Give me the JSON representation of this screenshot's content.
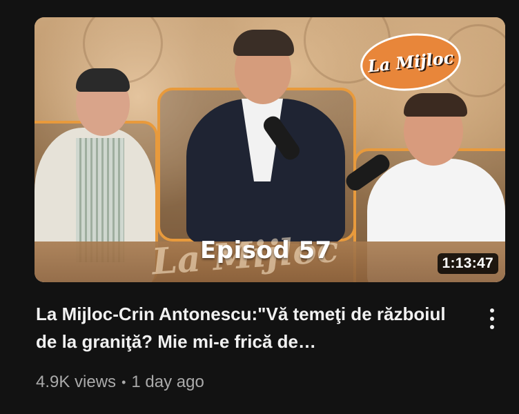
{
  "video": {
    "thumbnail": {
      "logo_text": "La Mijloc",
      "episode_text": "Episod 57",
      "watermark_text": "La Mijloc",
      "duration": "1:13:47"
    },
    "title": "La Mijloc-Crin Antonescu:\"Vă temeţi de războiul de la graniţă? Mie mi-e frică de…",
    "views": "4.9K views",
    "separator": "•",
    "age": "1 day ago"
  },
  "icons": {
    "menu": "more-vertical-icon"
  },
  "colors": {
    "background": "#121212",
    "title_text": "#f1f1f1",
    "meta_text": "#aaaaaa",
    "accent_orange": "#e89a3c"
  }
}
